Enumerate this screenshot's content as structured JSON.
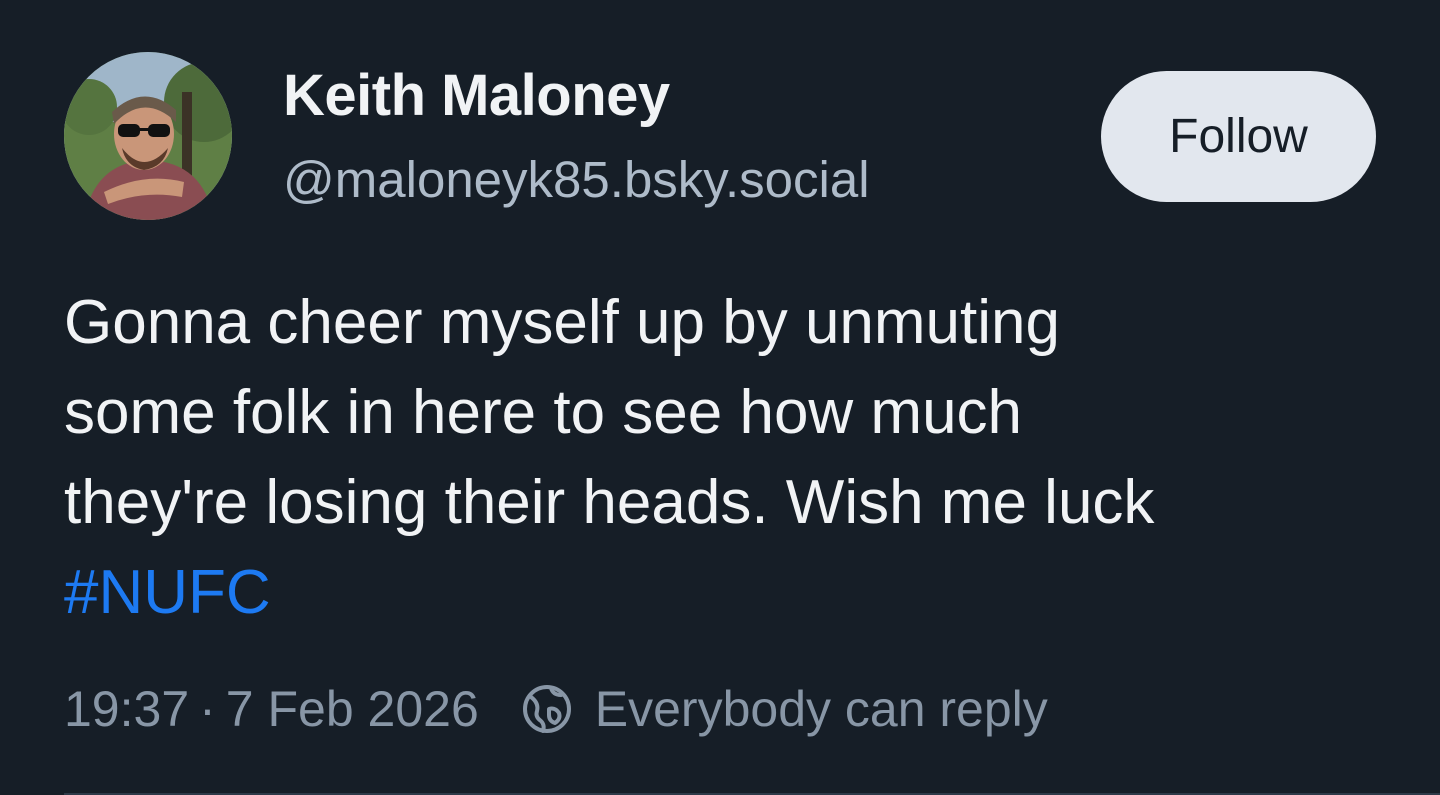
{
  "author": {
    "display_name": "Keith Maloney",
    "handle": "@maloneyk85.bsky.social",
    "avatar_icon": "user-avatar-photo"
  },
  "follow_label": "Follow",
  "post": {
    "lines": [
      "Gonna cheer myself up by unmuting",
      "some folk in here to see how much",
      "they're losing their heads. Wish me luck"
    ],
    "hashtag": "#NUFC"
  },
  "meta": {
    "time": "19:37",
    "separator": "·",
    "date": "7 Feb 2026",
    "reply_setting": "Everybody can reply",
    "reply_icon": "globe-icon"
  },
  "colors": {
    "background": "#161e27",
    "text": "#f1f3f5",
    "handle": "#aebbc9",
    "meta": "#8896a6",
    "link": "#1d7af2",
    "button_bg": "#e2e7ee"
  }
}
